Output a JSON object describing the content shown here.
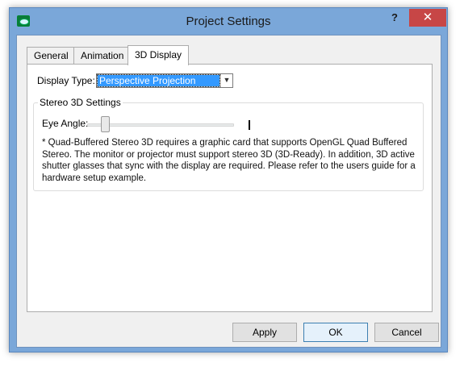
{
  "window": {
    "title": "Project Settings",
    "help_label": "?",
    "close_label": "✕"
  },
  "tabs": [
    {
      "label": "General",
      "active": false
    },
    {
      "label": "Animation",
      "active": false
    },
    {
      "label": "3D Display",
      "active": true
    }
  ],
  "display": {
    "type_label": "Display Type:",
    "type_value": "Perspective Projection"
  },
  "stereo": {
    "group_title": "Stereo 3D Settings",
    "eye_angle_label": "Eye Angle:",
    "eye_angle_slider_fraction": 0.1,
    "note": "* Quad-Buffered Stereo 3D requires a graphic card that supports OpenGL Quad Buffered Stereo. The monitor or projector must support stereo 3D (3D-Ready). In addition, 3D active shutter glasses that sync with the display are required. Please refer to the users guide for a hardware setup example."
  },
  "buttons": {
    "apply": "Apply",
    "ok": "OK",
    "cancel": "Cancel"
  },
  "colors": {
    "frame": "#7aa7d9",
    "close": "#c74646",
    "selection": "#3399ff"
  }
}
